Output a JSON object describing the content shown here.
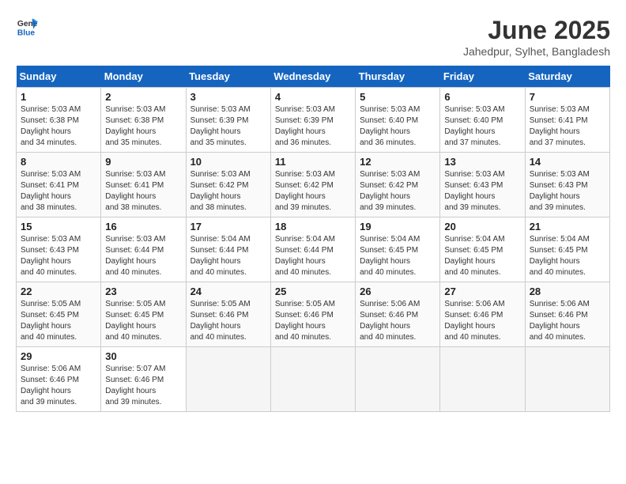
{
  "header": {
    "logo_general": "General",
    "logo_blue": "Blue",
    "title": "June 2025",
    "subtitle": "Jahedpur, Sylhet, Bangladesh"
  },
  "calendar": {
    "days_of_week": [
      "Sunday",
      "Monday",
      "Tuesday",
      "Wednesday",
      "Thursday",
      "Friday",
      "Saturday"
    ],
    "weeks": [
      [
        {
          "day": "",
          "empty": true
        },
        {
          "day": "",
          "empty": true
        },
        {
          "day": "",
          "empty": true
        },
        {
          "day": "",
          "empty": true
        },
        {
          "day": "",
          "empty": true
        },
        {
          "day": "",
          "empty": true
        },
        {
          "day": "",
          "empty": true
        }
      ],
      [
        {
          "day": "1",
          "sunrise": "5:03 AM",
          "sunset": "6:38 PM",
          "daylight": "13 hours and 34 minutes."
        },
        {
          "day": "2",
          "sunrise": "5:03 AM",
          "sunset": "6:38 PM",
          "daylight": "13 hours and 35 minutes."
        },
        {
          "day": "3",
          "sunrise": "5:03 AM",
          "sunset": "6:39 PM",
          "daylight": "13 hours and 35 minutes."
        },
        {
          "day": "4",
          "sunrise": "5:03 AM",
          "sunset": "6:39 PM",
          "daylight": "13 hours and 36 minutes."
        },
        {
          "day": "5",
          "sunrise": "5:03 AM",
          "sunset": "6:40 PM",
          "daylight": "13 hours and 36 minutes."
        },
        {
          "day": "6",
          "sunrise": "5:03 AM",
          "sunset": "6:40 PM",
          "daylight": "13 hours and 37 minutes."
        },
        {
          "day": "7",
          "sunrise": "5:03 AM",
          "sunset": "6:41 PM",
          "daylight": "13 hours and 37 minutes."
        }
      ],
      [
        {
          "day": "8",
          "sunrise": "5:03 AM",
          "sunset": "6:41 PM",
          "daylight": "13 hours and 38 minutes."
        },
        {
          "day": "9",
          "sunrise": "5:03 AM",
          "sunset": "6:41 PM",
          "daylight": "13 hours and 38 minutes."
        },
        {
          "day": "10",
          "sunrise": "5:03 AM",
          "sunset": "6:42 PM",
          "daylight": "13 hours and 38 minutes."
        },
        {
          "day": "11",
          "sunrise": "5:03 AM",
          "sunset": "6:42 PM",
          "daylight": "13 hours and 39 minutes."
        },
        {
          "day": "12",
          "sunrise": "5:03 AM",
          "sunset": "6:42 PM",
          "daylight": "13 hours and 39 minutes."
        },
        {
          "day": "13",
          "sunrise": "5:03 AM",
          "sunset": "6:43 PM",
          "daylight": "13 hours and 39 minutes."
        },
        {
          "day": "14",
          "sunrise": "5:03 AM",
          "sunset": "6:43 PM",
          "daylight": "13 hours and 39 minutes."
        }
      ],
      [
        {
          "day": "15",
          "sunrise": "5:03 AM",
          "sunset": "6:43 PM",
          "daylight": "13 hours and 40 minutes."
        },
        {
          "day": "16",
          "sunrise": "5:03 AM",
          "sunset": "6:44 PM",
          "daylight": "13 hours and 40 minutes."
        },
        {
          "day": "17",
          "sunrise": "5:04 AM",
          "sunset": "6:44 PM",
          "daylight": "13 hours and 40 minutes."
        },
        {
          "day": "18",
          "sunrise": "5:04 AM",
          "sunset": "6:44 PM",
          "daylight": "13 hours and 40 minutes."
        },
        {
          "day": "19",
          "sunrise": "5:04 AM",
          "sunset": "6:45 PM",
          "daylight": "13 hours and 40 minutes."
        },
        {
          "day": "20",
          "sunrise": "5:04 AM",
          "sunset": "6:45 PM",
          "daylight": "13 hours and 40 minutes."
        },
        {
          "day": "21",
          "sunrise": "5:04 AM",
          "sunset": "6:45 PM",
          "daylight": "13 hours and 40 minutes."
        }
      ],
      [
        {
          "day": "22",
          "sunrise": "5:05 AM",
          "sunset": "6:45 PM",
          "daylight": "13 hours and 40 minutes."
        },
        {
          "day": "23",
          "sunrise": "5:05 AM",
          "sunset": "6:45 PM",
          "daylight": "13 hours and 40 minutes."
        },
        {
          "day": "24",
          "sunrise": "5:05 AM",
          "sunset": "6:46 PM",
          "daylight": "13 hours and 40 minutes."
        },
        {
          "day": "25",
          "sunrise": "5:05 AM",
          "sunset": "6:46 PM",
          "daylight": "13 hours and 40 minutes."
        },
        {
          "day": "26",
          "sunrise": "5:06 AM",
          "sunset": "6:46 PM",
          "daylight": "13 hours and 40 minutes."
        },
        {
          "day": "27",
          "sunrise": "5:06 AM",
          "sunset": "6:46 PM",
          "daylight": "13 hours and 40 minutes."
        },
        {
          "day": "28",
          "sunrise": "5:06 AM",
          "sunset": "6:46 PM",
          "daylight": "13 hours and 40 minutes."
        }
      ],
      [
        {
          "day": "29",
          "sunrise": "5:06 AM",
          "sunset": "6:46 PM",
          "daylight": "13 hours and 39 minutes."
        },
        {
          "day": "30",
          "sunrise": "5:07 AM",
          "sunset": "6:46 PM",
          "daylight": "13 hours and 39 minutes."
        },
        {
          "day": "",
          "empty": true
        },
        {
          "day": "",
          "empty": true
        },
        {
          "day": "",
          "empty": true
        },
        {
          "day": "",
          "empty": true
        },
        {
          "day": "",
          "empty": true
        }
      ]
    ]
  }
}
